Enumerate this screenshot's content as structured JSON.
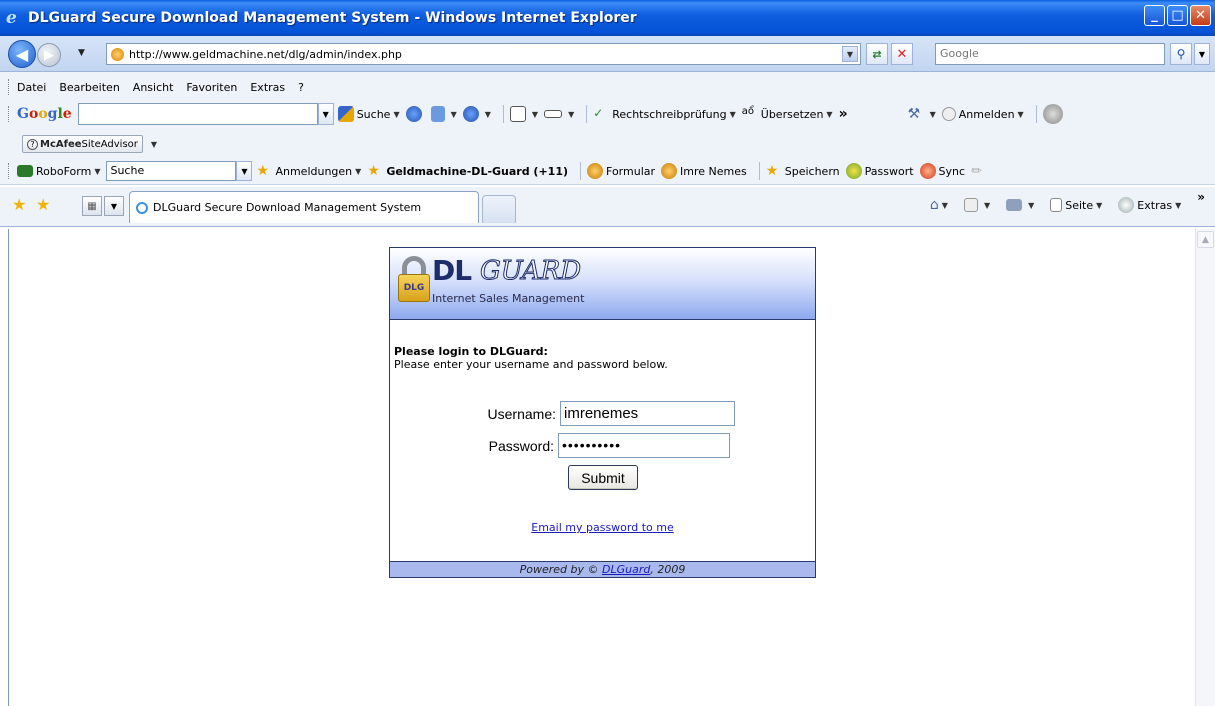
{
  "window": {
    "title": "DLGuard Secure Download Management System - Windows Internet Explorer",
    "buttons": {
      "minimize": "_",
      "maximize": "□",
      "close": "✕"
    }
  },
  "address": {
    "url": "http://www.geldmachine.net/dlg/admin/index.php",
    "search_placeholder": "Google"
  },
  "menu": [
    "Datei",
    "Bearbeiten",
    "Ansicht",
    "Favoriten",
    "Extras",
    "?"
  ],
  "google_toolbar": {
    "logo": "Google",
    "search": "Suche",
    "spellcheck": "Rechtschreibprüfung",
    "translate": "Übersetzen",
    "more": "»",
    "signin": "Anmelden"
  },
  "mcafee": {
    "brand": "McAfee",
    "product": "SiteAdvisor"
  },
  "roboform": {
    "name": "RoboForm",
    "search_value": "Suche",
    "logins": "Anmeldungen",
    "bookmark": "Geldmachine-DL-Guard (+11)",
    "form": "Formular",
    "identity": "Imre Nemes",
    "save": "Speichern",
    "password": "Passwort",
    "sync": "Sync"
  },
  "tabs": {
    "active": "DLGuard Secure Download Management System"
  },
  "commandbar": {
    "page": "Seite",
    "tools": "Extras",
    "more": "»"
  },
  "dlguard": {
    "brand": "DL",
    "brand_script": "GUARD",
    "tagline": "Internet Sales Management",
    "lock_text": "DLG",
    "login_title": "Please login to DLGuard:",
    "login_sub": "Please enter your username and password below.",
    "username_label": "Username:",
    "username_value": "imrenemes",
    "password_label": "Password:",
    "password_value": "••••••••••",
    "submit": "Submit",
    "email_link": "Email my password to me",
    "footer_prefix": "Powered by ©",
    "footer_link": "DLGuard",
    "footer_suffix": ", 2009"
  },
  "colors": {
    "titlebar": "#0452d6",
    "dlg_header": "#8ea9ee",
    "dlg_footer": "#a9b9ee",
    "link": "#1b1bbb"
  }
}
